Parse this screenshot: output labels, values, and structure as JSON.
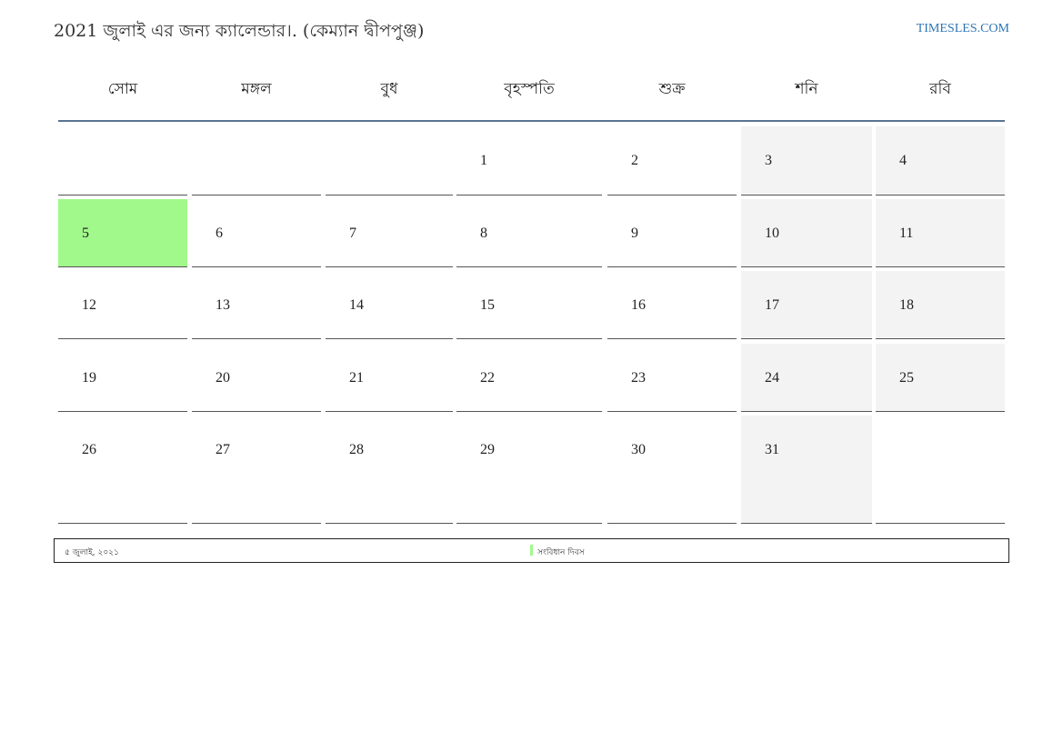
{
  "header": {
    "title": "2021 জুলাই এর জন্য ক্যালেন্ডার।. (কেম্যান দ্বীপপুঞ্জ)",
    "site": "TIMESLES.COM"
  },
  "weekdays": [
    "সোম",
    "মঙ্গল",
    "বুধ",
    "বৃহস্পতি",
    "শুক্র",
    "শনি",
    "রবি"
  ],
  "weeks": [
    [
      "",
      "",
      "",
      "1",
      "2",
      "3",
      "4"
    ],
    [
      "5",
      "6",
      "7",
      "8",
      "9",
      "10",
      "11"
    ],
    [
      "12",
      "13",
      "14",
      "15",
      "16",
      "17",
      "18"
    ],
    [
      "19",
      "20",
      "21",
      "22",
      "23",
      "24",
      "25"
    ],
    [
      "26",
      "27",
      "28",
      "29",
      "30",
      "31",
      ""
    ]
  ],
  "holiday_day": "5",
  "colors": {
    "holiday": "#a1f98b",
    "weekend": "#f3f3f3",
    "header_rule": "#5b7393",
    "site_link": "#2e74b5"
  },
  "legend": {
    "date": "৫ জুলাই, ২০২১",
    "name": "সংবিধান দিবস"
  }
}
